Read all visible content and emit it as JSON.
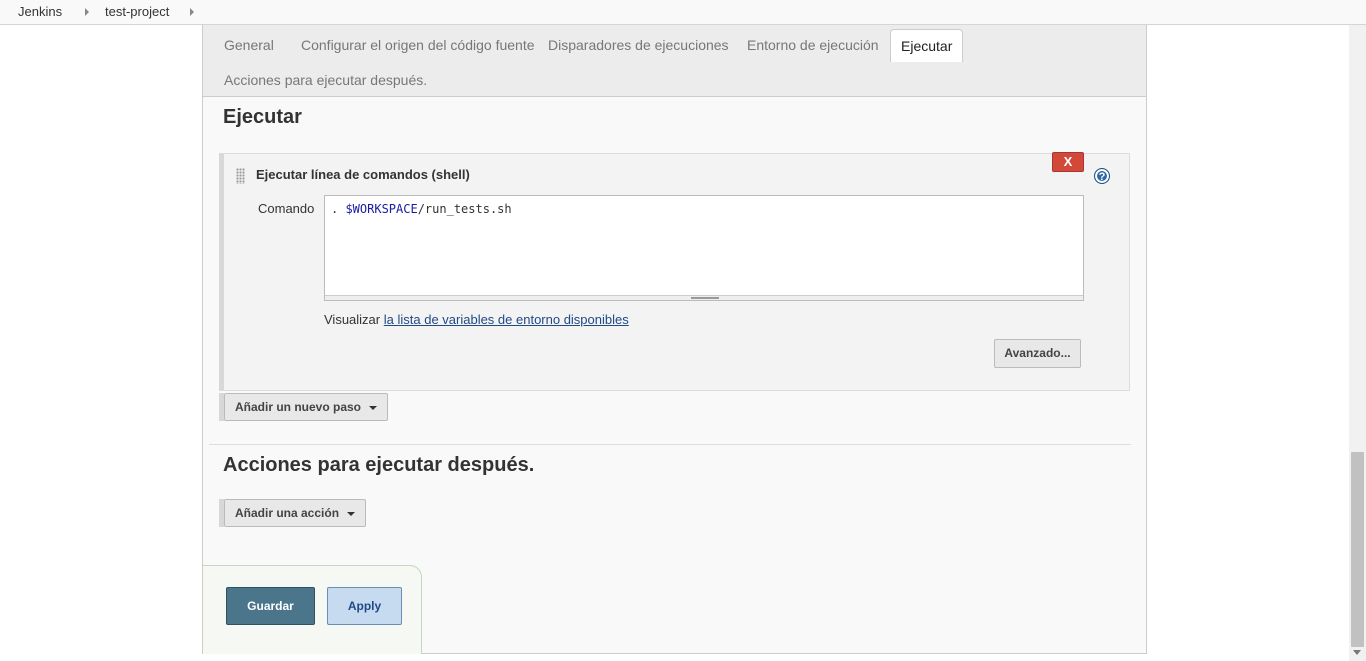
{
  "breadcrumb": {
    "items": [
      "Jenkins",
      "test-project"
    ]
  },
  "tabs": {
    "general": "General",
    "scm": "Configurar el origen del código fuente",
    "triggers": "Disparadores de ejecuciones",
    "environment": "Entorno de ejecución",
    "build": "Ejecutar",
    "post_build": "Acciones para ejecutar después."
  },
  "build_section": {
    "title": "Ejecutar",
    "step": {
      "title": "Ejecutar línea de comandos (shell)",
      "delete_label": "X",
      "help_label": "?",
      "command_label": "Comando",
      "command_prefix": ". ",
      "command_var": "$WORKSPACE",
      "command_suffix": "/run_tests.sh",
      "env_prefix": "Visualizar",
      "env_link": "la lista de variables de entorno disponibles",
      "advanced_label": "Avanzado..."
    },
    "add_step_label": "Añadir un nuevo paso"
  },
  "post_build_section": {
    "title": "Acciones para ejecutar después.",
    "add_action_label": "Añadir una acción"
  },
  "actions": {
    "save_label": "Guardar",
    "apply_label": "Apply"
  },
  "colors": {
    "save": "#4b758b",
    "apply": "#c6dbef",
    "delete": "#d24939",
    "link": "#204a87"
  }
}
